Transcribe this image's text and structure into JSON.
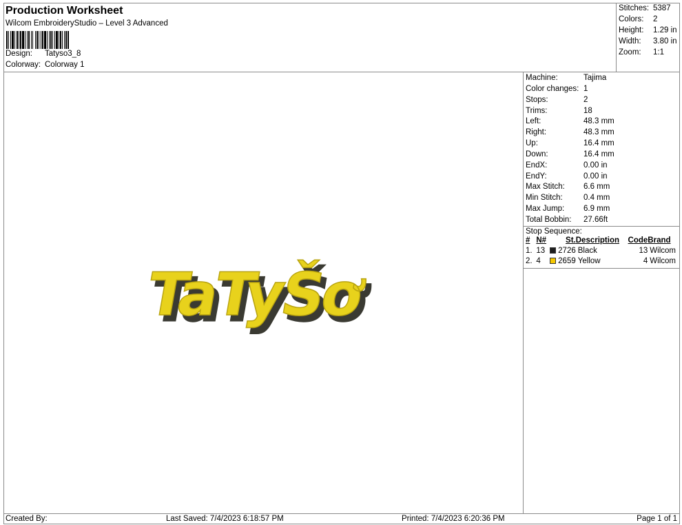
{
  "header": {
    "title": "Production Worksheet",
    "subtitle": "Wilcom EmbroideryStudio – Level 3 Advanced",
    "design_label": "Design:",
    "design": "Tatyso3_8",
    "colorway_label": "Colorway:",
    "colorway": "Colorway 1"
  },
  "summary": [
    {
      "k": "Stitches:",
      "v": "5387"
    },
    {
      "k": "Colors:",
      "v": "2"
    },
    {
      "k": "Height:",
      "v": "1.29 in"
    },
    {
      "k": "Width:",
      "v": "3.80 in"
    },
    {
      "k": "Zoom:",
      "v": "1:1"
    }
  ],
  "details": [
    {
      "k": "Machine:",
      "v": "Tajima"
    },
    {
      "k": "Color changes:",
      "v": "1"
    },
    {
      "k": "Stops:",
      "v": "2"
    },
    {
      "k": "Trims:",
      "v": "18"
    },
    {
      "k": "Left:",
      "v": "48.3 mm"
    },
    {
      "k": "Right:",
      "v": "48.3 mm"
    },
    {
      "k": "Up:",
      "v": "16.4 mm"
    },
    {
      "k": "Down:",
      "v": "16.4 mm"
    },
    {
      "k": "EndX:",
      "v": "0.00 in"
    },
    {
      "k": "EndY:",
      "v": "0.00 in"
    },
    {
      "k": "Max Stitch:",
      "v": "6.6 mm"
    },
    {
      "k": "Min Stitch:",
      "v": "0.4 mm"
    },
    {
      "k": "Max Jump:",
      "v": "6.9 mm"
    },
    {
      "k": "Total Bobbin:",
      "v": "27.66ft"
    }
  ],
  "stop_sequence": {
    "label": "Stop Sequence:",
    "headers": [
      "#",
      "N#",
      "St.",
      "Description",
      "Code",
      "Brand"
    ],
    "rows": [
      {
        "num": "1.",
        "n": "13",
        "color": "#1e1e1e",
        "st": "2726",
        "desc": "Black",
        "code": "13",
        "brand": "Wilcom"
      },
      {
        "num": "2.",
        "n": "4",
        "color": "#f5c800",
        "st": "2659",
        "desc": "Yellow",
        "code": "4",
        "brand": "Wilcom"
      }
    ]
  },
  "design_preview": {
    "text": "TaTyŠơ",
    "fill": "#e8d21c",
    "shadow": "#3a3a32"
  },
  "footer": {
    "created": "Created By:",
    "saved": "Last Saved: 7/4/2023 6:18:57 PM",
    "printed": "Printed: 7/4/2023 6:20:36 PM",
    "page": "Page 1 of 1"
  }
}
